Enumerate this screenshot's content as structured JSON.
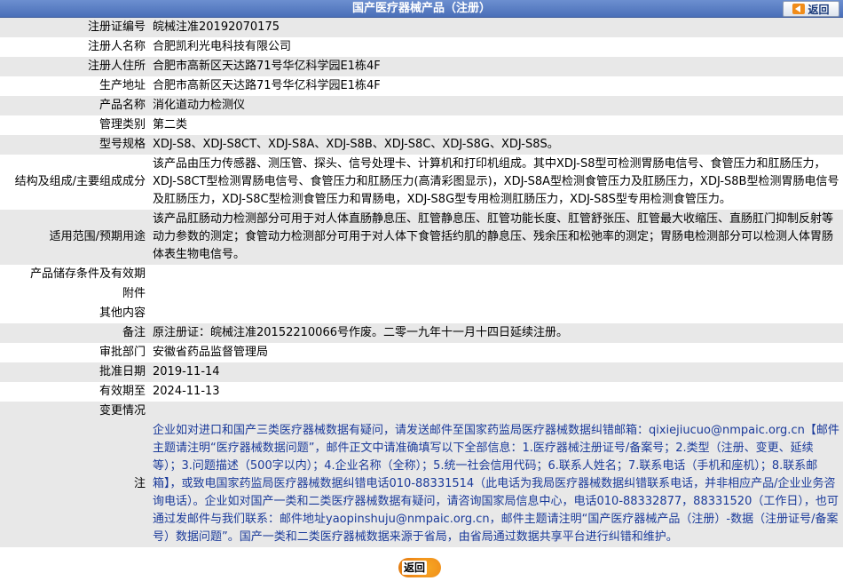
{
  "header": {
    "title": "国产医疗器械产品（注册）",
    "back_label": "返回"
  },
  "rows": [
    {
      "label": "注册证编号",
      "value": "皖械注准20192070175"
    },
    {
      "label": "注册人名称",
      "value": "合肥凯利光电科技有限公司"
    },
    {
      "label": "注册人住所",
      "value": "合肥市高新区天达路71号华亿科学园E1栋4F"
    },
    {
      "label": "生产地址",
      "value": "合肥市高新区天达路71号华亿科学园E1栋4F"
    },
    {
      "label": "产品名称",
      "value": "消化道动力检测仪"
    },
    {
      "label": "管理类别",
      "value": "第二类"
    },
    {
      "label": "型号规格",
      "value": "XDJ-S8、XDJ-S8CT、XDJ-S8A、XDJ-S8B、XDJ-S8C、XDJ-S8G、XDJ-S8S。"
    },
    {
      "label": "结构及组成/主要组成成分",
      "value": "该产品由压力传感器、测压管、探头、信号处理卡、计算机和打印机组成。其中XDJ-S8型可检测胃肠电信号、食管压力和肛肠压力，XDJ-S8CT型检测胃肠电信号、食管压力和肛肠压力(高清彩图显示)，XDJ-S8A型检测食管压力及肛肠压力，XDJ-S8B型检测胃肠电信号及肛肠压力，XDJ-S8C型检测食管压力和胃肠电，XDJ-S8G型专用检测肛肠压力，XDJ-S8S型专用检测食管压力。"
    },
    {
      "label": "适用范围/预期用途",
      "value": "该产品肛肠动力检测部分可用于对人体直肠静息压、肛管静息压、肛管功能长度、肛管舒张压、肛管最大收缩压、直肠肛门抑制反射等动力参数的测定；食管动力检测部分可用于对人体下食管括约肌的静息压、残余压和松弛率的测定；胃肠电检测部分可以检测人体胃肠体表生物电信号。"
    },
    {
      "label": "产品储存条件及有效期",
      "value": ""
    },
    {
      "label": "附件",
      "value": ""
    },
    {
      "label": "其他内容",
      "value": ""
    },
    {
      "label": "备注",
      "value": "原注册证：皖械注准20152210066号作废。二零一九年十一月十四日延续注册。"
    },
    {
      "label": "审批部门",
      "value": "安徽省药品监督管理局"
    },
    {
      "label": "批准日期",
      "value": "2019-11-14"
    },
    {
      "label": "有效期至",
      "value": "2024-11-13"
    },
    {
      "label": "变更情况",
      "value": ""
    }
  ],
  "note": {
    "label": "注",
    "text": "企业如对进口和国产三类医疗器械数据有疑问，请发送邮件至国家药监局医疗器械数据纠错邮箱：qixiejiucuo@nmpaic.org.cn【邮件主题请注明“医疗器械数据问题”，邮件正文中请准确填写以下全部信息：1.医疗器械注册证号/备案号；2.类型（注册、变更、延续等）；3.问题描述（500字以内）；4.企业名称（全称）；5.统一社会信用代码；6.联系人姓名；7.联系电话（手机和座机）；8.联系邮箱】，或致电国家药监局医疗器械数据纠错电话010-88331514（此电话为我局医疗器械数据纠错联系电话，并非相应产品/企业业务咨询电话）。企业如对国产一类和二类医疗器械数据有疑问，请咨询国家局信息中心，电话010-88332877，88331520（工作日），也可通过发邮件与我们联系：邮件地址yaopinshuju@nmpaic.org.cn，邮件主题请注明“国产医疗器械产品（注册）-数据（注册证号/备案号）数据问题”。国产一类和二类医疗器械数据来源于省局，由省局通过数据共享平台进行纠错和维护。"
  },
  "footer": {
    "back_label": "返回"
  },
  "colors": {
    "title_bar": "#4a6fb8",
    "row_alt": "#e8e8e8",
    "note_text": "#1a3a9a",
    "back_button_accent": "#f08c1a"
  }
}
